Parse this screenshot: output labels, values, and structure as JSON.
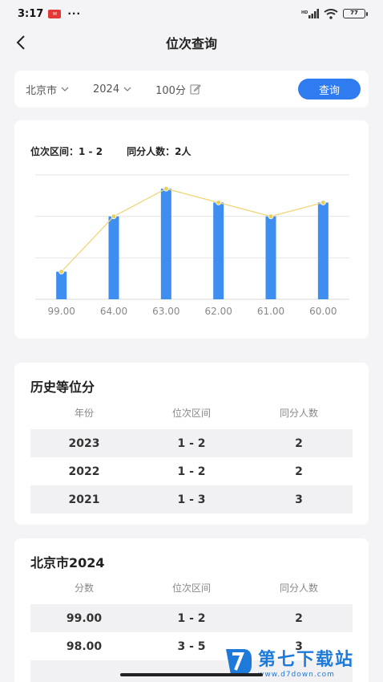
{
  "status_bar": {
    "time": "3:17",
    "dots": "···",
    "network": "HD",
    "battery": "77"
  },
  "nav": {
    "title": "位次查询"
  },
  "filter": {
    "province": "北京市",
    "year": "2024",
    "score": "100分",
    "query_label": "查询"
  },
  "chart_info": {
    "rank_label": "位次区间：",
    "rank_value": "1 - 2",
    "same_label": "同分人数：",
    "same_value": "2人"
  },
  "chart_data": {
    "type": "bar",
    "categories": [
      "99.00",
      "64.00",
      "63.00",
      "62.00",
      "61.00",
      "60.00"
    ],
    "values": [
      1,
      3,
      4,
      3.5,
      3,
      3.5
    ],
    "ylim": [
      0,
      4.5
    ],
    "grid": true,
    "colors": {
      "bar": "#3d8ef0",
      "line": "#f0d67a",
      "point": "#e8d060"
    }
  },
  "history": {
    "title": "历史等位分",
    "headers": [
      "年份",
      "位次区间",
      "同分人数"
    ],
    "rows": [
      [
        "2023",
        "1 - 2",
        "2"
      ],
      [
        "2022",
        "1 - 2",
        "2"
      ],
      [
        "2021",
        "1 - 3",
        "3"
      ]
    ]
  },
  "beijing": {
    "title": "北京市2024",
    "headers": [
      "分数",
      "位次区间",
      "同分人数"
    ],
    "rows": [
      [
        "99.00",
        "1 - 2",
        "2"
      ],
      [
        "98.00",
        "3 - 5",
        "3"
      ]
    ]
  },
  "watermark": {
    "text": "第七下载站",
    "url": "www.d7down.com"
  }
}
